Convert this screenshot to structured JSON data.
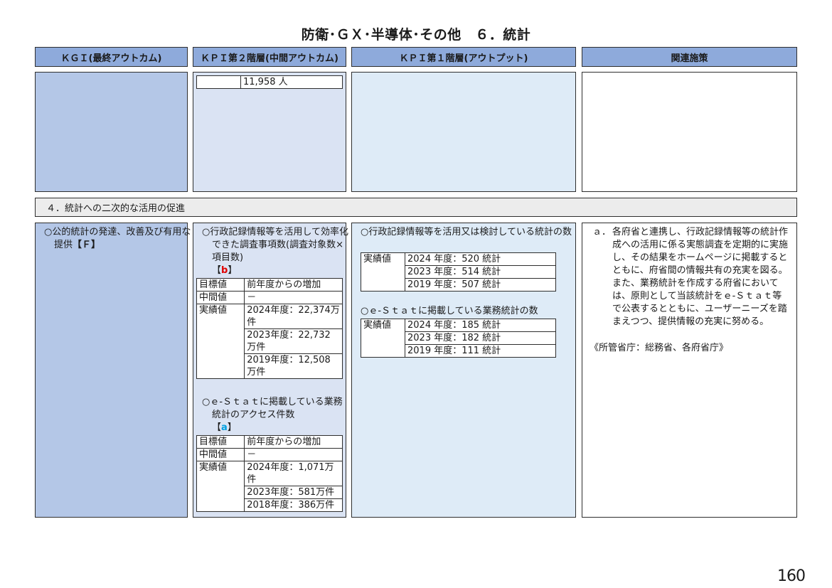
{
  "page": {
    "title": "防衛･ＧＸ･半導体･その他　６．統計",
    "page_number": "160"
  },
  "headers": {
    "kgi": "ＫＧＩ(最終アウトカム)",
    "kpi2": "ＫＰＩ第２階層(中間アウトカム)",
    "kpi1": "ＫＰＩ第１階層(アウトプット)",
    "related": "関連施策"
  },
  "top_row": {
    "kpi2_value": "11,958 人"
  },
  "section": {
    "label": "４．統計への二次的な活用の促進"
  },
  "kgi": {
    "text": "○公的統計の発達、改善及び有用な提供",
    "tag": "【Ｆ】"
  },
  "kpi2_a": {
    "text": "○行政記録情報等を活用して効率化できた調査事項数(調査対象数×項目数)",
    "tag_open": "【",
    "tag_letter": "b",
    "tag_close": "】",
    "target_label": "目標値",
    "target_value": "前年度からの増加",
    "mid_label": "中間値",
    "mid_value": "－",
    "actual_label": "実績値",
    "actual_values": [
      "2024年度：22,374万件",
      "2023年度：22,732 万件",
      "2019年度：12,508 万件"
    ]
  },
  "kpi2_b": {
    "text": "○ｅ-Ｓｔａｔに掲載している業務統計のアクセス件数",
    "tag_open": "【",
    "tag_letter": "a",
    "tag_close": "】",
    "target_label": "目標値",
    "target_value": "前年度からの増加",
    "mid_label": "中間値",
    "mid_value": "－",
    "actual_label": "実績値",
    "actual_values": [
      "2024年度：1,071万件",
      "2023年度：581万件",
      "2018年度：386万件"
    ]
  },
  "kpi1_a": {
    "text": "○行政記録情報等を活用又は検討している統計の数",
    "actual_label": "実績値",
    "actual_values": [
      "2024 年度：520 統計",
      "2023 年度：514 統計",
      "2019 年度：507 統計"
    ]
  },
  "kpi1_b": {
    "text": "○ｅ-Ｓｔａｔに掲載している業務統計の数",
    "actual_label": "実績値",
    "actual_values": [
      "2024 年度：185 統計",
      "2023 年度：182 統計",
      "2019 年度：111 統計"
    ]
  },
  "related": {
    "marker": "ａ．",
    "text": "各府省と連携し、行政記録情報等の統計作成への活用に係る実態調査を定期的に実施し、その結果をホームページに掲載するとともに、府省間の情報共有の充実を図る。また、業務統計を作成する府省においては、原則として当該統計をｅ-Ｓｔａｔ等で公表するとともに、ユーザーニーズを踏まえつつ、提供情報の充実に努める。",
    "ministry": "《所管省庁：総務省、各府省庁》"
  }
}
